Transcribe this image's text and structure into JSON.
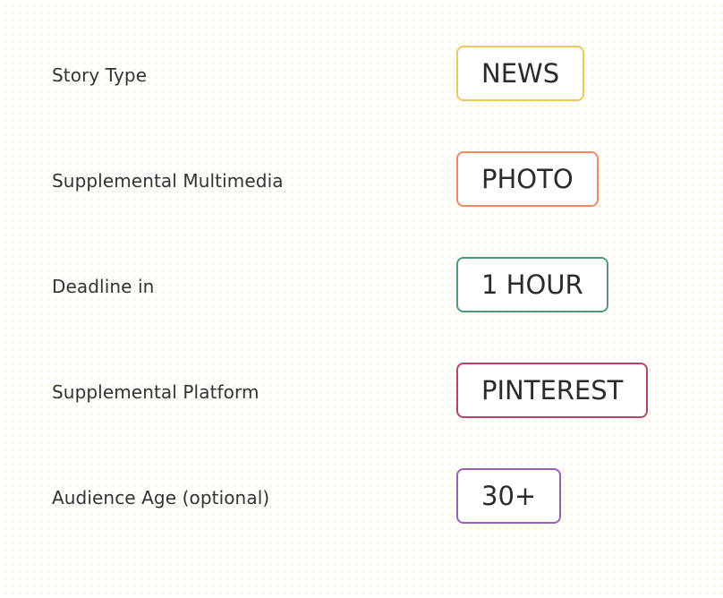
{
  "fields": [
    {
      "label": "Story Type",
      "value": "NEWS",
      "color": "#f0c75e"
    },
    {
      "label": "Supplemental Multimedia",
      "value": "PHOTO",
      "color": "#ef8a62"
    },
    {
      "label": "Deadline in",
      "value": "1 HOUR",
      "color": "#4e9a7c"
    },
    {
      "label": "Supplemental Platform",
      "value": "PINTEREST",
      "color": "#b5426b"
    },
    {
      "label": "Audience Age (optional)",
      "value": "30+",
      "color": "#9b5fb5"
    }
  ]
}
